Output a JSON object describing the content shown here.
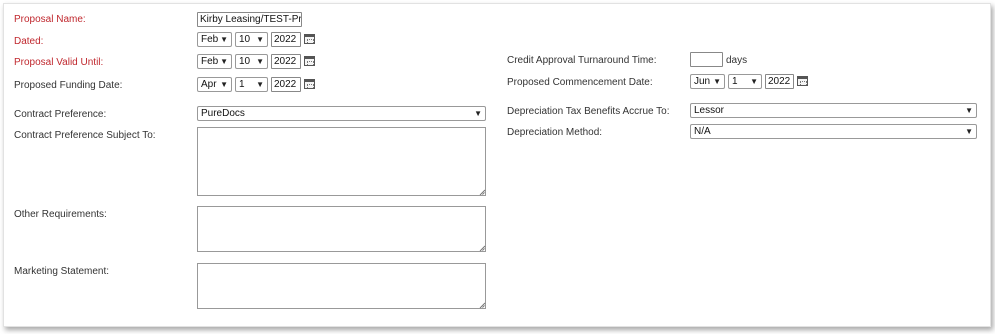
{
  "left": {
    "proposal_name": {
      "label": "Proposal Name:",
      "value": "Kirby Leasing/TEST-Prev"
    },
    "dated": {
      "label": "Dated:",
      "month": "Feb",
      "day": "10",
      "year": "2022"
    },
    "valid_until": {
      "label": "Proposal Valid Until:",
      "month": "Feb",
      "day": "10",
      "year": "2022"
    },
    "funding_date": {
      "label": "Proposed Funding Date:",
      "month": "Apr",
      "day": "1",
      "year": "2022"
    },
    "contract_preference": {
      "label": "Contract Preference:",
      "value": "PureDocs"
    },
    "contract_subject_to": {
      "label": "Contract Preference Subject To:",
      "value": ""
    },
    "other_requirements": {
      "label": "Other Requirements:",
      "value": ""
    },
    "marketing_statement": {
      "label": "Marketing Statement:",
      "value": ""
    }
  },
  "right": {
    "turnaround": {
      "label": "Credit Approval Turnaround Time:",
      "value": "",
      "unit": "days"
    },
    "commencement": {
      "label": "Proposed Commencement Date:",
      "month": "Jun",
      "day": "1",
      "year": "2022"
    },
    "depreciation_accrue": {
      "label": "Depreciation Tax Benefits Accrue To:",
      "value": "Lessor"
    },
    "depreciation_method": {
      "label": "Depreciation Method:",
      "value": "N/A"
    }
  },
  "icons": {
    "calendar": "calendar-icon",
    "dropdown": "chevron-down-icon",
    "resize": "resize-grip-icon"
  },
  "colors": {
    "required_label": "#c0282e",
    "normal_label": "#333333"
  }
}
